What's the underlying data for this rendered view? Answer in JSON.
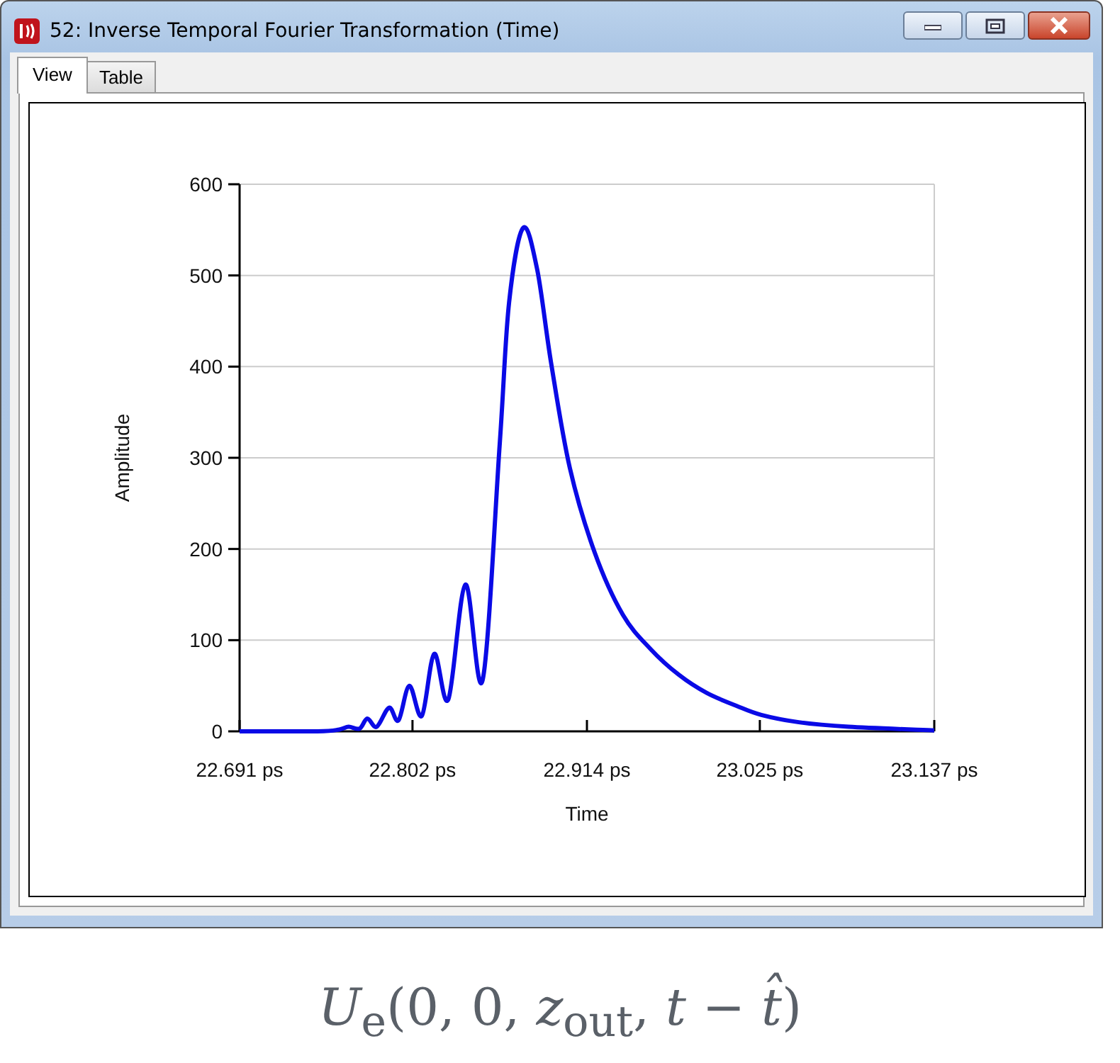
{
  "window": {
    "title": "52: Inverse Temporal Fourier Transformation (Time)"
  },
  "tabs": [
    {
      "label": "View",
      "selected": true
    },
    {
      "label": "Table",
      "selected": false
    }
  ],
  "chart_data": {
    "type": "line",
    "grid": true,
    "xlabel": "Time",
    "ylabel": "Amplitude",
    "xlim": [
      22.691,
      23.137
    ],
    "ylim": [
      0,
      600
    ],
    "xticks": [
      {
        "value": 22.691,
        "label": "22.691 ps"
      },
      {
        "value": 22.802,
        "label": "22.802 ps"
      },
      {
        "value": 22.914,
        "label": "22.914 ps"
      },
      {
        "value": 23.025,
        "label": "23.025 ps"
      },
      {
        "value": 23.137,
        "label": "23.137 ps"
      }
    ],
    "yticks": [
      0,
      100,
      200,
      300,
      400,
      500,
      600
    ],
    "x": [
      22.691,
      22.741,
      22.755,
      22.761,
      22.768,
      22.773,
      22.779,
      22.787,
      22.793,
      22.8,
      22.808,
      22.816,
      22.825,
      22.836,
      22.847,
      22.858,
      22.864,
      22.873,
      22.882,
      22.891,
      22.903,
      22.919,
      22.937,
      22.955,
      22.973,
      22.991,
      23.01,
      23.026,
      23.05,
      23.082,
      23.137
    ],
    "series": [
      {
        "color": "#0a0ae6",
        "values": [
          0,
          0,
          2,
          5,
          3,
          14,
          5,
          26,
          12,
          50,
          17,
          85,
          35,
          161,
          56,
          315,
          470,
          552,
          507,
          404,
          289,
          196,
          128,
          90,
          62,
          42,
          28,
          18,
          10,
          5,
          1
        ]
      }
    ]
  },
  "caption": "*U*$_{e}$(0, 0, *z*$_{out}$, *t* − *t̂*)"
}
